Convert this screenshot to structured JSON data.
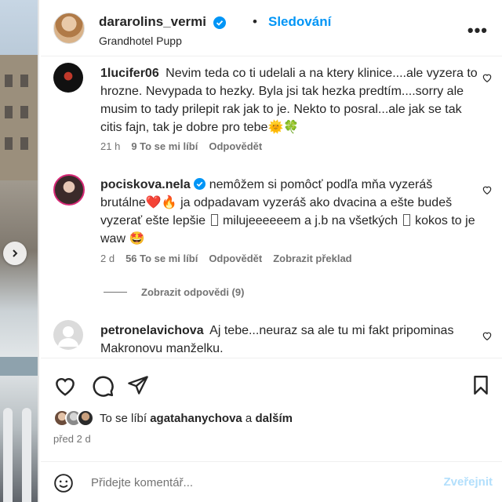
{
  "header": {
    "username": "dararolins_vermi",
    "separator": "•",
    "follow_label": "Sledování",
    "location": "Grandhotel Pupp",
    "more_icon": "more-horizontal-icon"
  },
  "comments": [
    {
      "username": "1lucifer06",
      "text": "Nevim teda co ti udelali a na ktery klinice....ale vyzera to hrozne. Nevypada to hezky. Byla jsi tak hezka predtím....sorry ale musim to tady prilepit rak jak to je. Nekto to posral...ale jak se tak citis fajn, tak je dobre pro tebe🌞🍀",
      "time": "21 h",
      "likes": "9 To se mi líbí",
      "reply": "Odpovědět"
    },
    {
      "username": "pociskova.nela",
      "text_a": "nemôžem si pomôcť podľa mňa vyzeráš brutálne❤️🔥 ja odpadavam vyzeráš ako dvacina a ešte budeš vyzerať ešte lepšie",
      "text_b": "milujeeeeeem a j.b na všetkých",
      "text_c": "kokos to je waw 🤩",
      "time": "2 d",
      "likes": "56 To se mi líbí",
      "reply": "Odpovědět",
      "translate": "Zobrazit překlad",
      "view_replies": "Zobrazit odpovědi (9)"
    },
    {
      "username": "petronelavichova",
      "text": "Aj tebe...neuraz sa ale tu mi fakt pripominas Makronovu manželku."
    }
  ],
  "likes_row": {
    "prefix": "To se líbí",
    "user": "agatahanychova",
    "conj": "a",
    "others": "dalším"
  },
  "date": "před 2 d",
  "composer": {
    "placeholder": "Přidejte komentář...",
    "post_label": "Zveřejnit"
  },
  "colors": {
    "accent": "#0095f6",
    "post_disabled": "#b2dffc",
    "heart_red": "#ed4956",
    "muted": "#737373"
  }
}
